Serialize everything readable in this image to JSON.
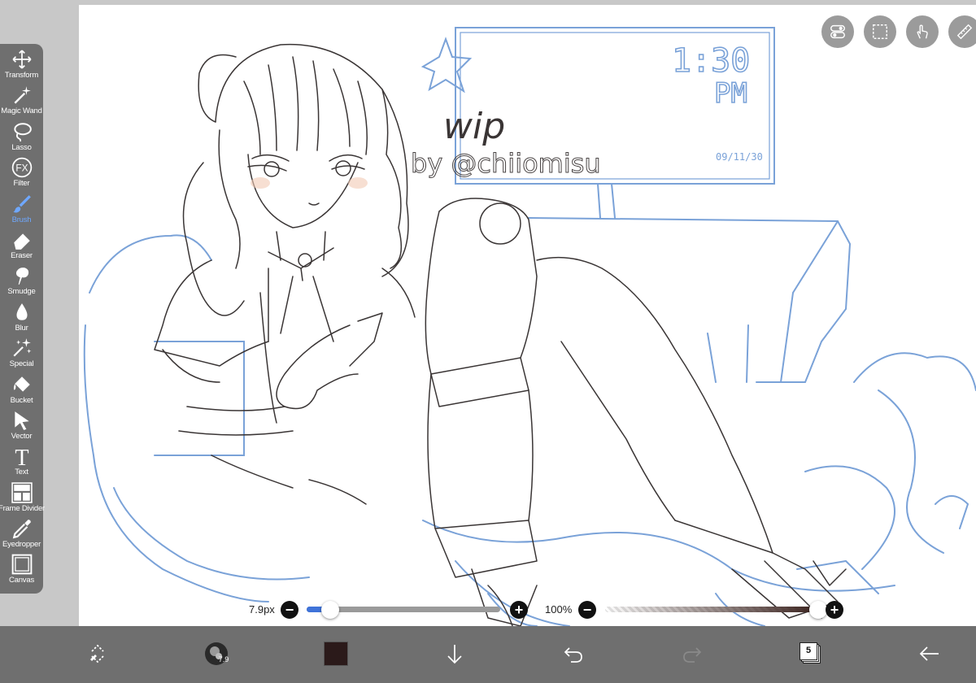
{
  "tools": [
    {
      "id": "transform",
      "label": "Transform",
      "icon": "move-arrows-icon",
      "active": false
    },
    {
      "id": "magic-wand",
      "label": "Magic Wand",
      "icon": "magic-wand-icon",
      "active": false
    },
    {
      "id": "lasso",
      "label": "Lasso",
      "icon": "lasso-icon",
      "active": false
    },
    {
      "id": "filter",
      "label": "Filter",
      "icon": "fx-icon",
      "active": false
    },
    {
      "id": "brush",
      "label": "Brush",
      "icon": "brush-icon",
      "active": true
    },
    {
      "id": "eraser",
      "label": "Eraser",
      "icon": "eraser-icon",
      "active": false
    },
    {
      "id": "smudge",
      "label": "Smudge",
      "icon": "smudge-icon",
      "active": false
    },
    {
      "id": "blur",
      "label": "Blur",
      "icon": "droplet-icon",
      "active": false
    },
    {
      "id": "special",
      "label": "Special",
      "icon": "sparkle-icon",
      "active": false
    },
    {
      "id": "bucket",
      "label": "Bucket",
      "icon": "bucket-icon",
      "active": false
    },
    {
      "id": "vector",
      "label": "Vector",
      "icon": "cursor-arrow-icon",
      "active": false
    },
    {
      "id": "text",
      "label": "Text",
      "icon": "text-t-icon",
      "active": false
    },
    {
      "id": "frame-divider",
      "label": "Frame Divider",
      "icon": "frame-divider-icon",
      "active": false
    },
    {
      "id": "eyedropper",
      "label": "Eyedropper",
      "icon": "eyedropper-icon",
      "active": false
    },
    {
      "id": "canvas",
      "label": "Canvas",
      "icon": "canvas-square-icon",
      "active": false
    }
  ],
  "topButtons": [
    "toggle-icon",
    "selection-rect-icon",
    "touch-hand-icon",
    "ruler-icon"
  ],
  "sliders": {
    "size": {
      "label": "7.9px",
      "fraction": 0.12,
      "fill": "#3f73d9"
    },
    "opacity": {
      "label": "100%",
      "fraction": 1.0
    }
  },
  "bottombar": {
    "items": [
      "swap-icon",
      "brush-preview-icon",
      "color-swatch",
      "down-arrow-icon",
      "undo-icon",
      "redo-icon",
      "layers-icon",
      "back-arrow-icon"
    ],
    "color": "#2b1a1a",
    "layers_count": "5"
  },
  "artwork": {
    "sign_time_line1": "1:30",
    "sign_time_line2": "PM",
    "sign_date": "09/11/30",
    "wip_text": "wip",
    "credit_text": "by @chiiomisu"
  },
  "colors": {
    "toolbar_bg": "#6f6f6f",
    "active_tool": "#6fa8ff",
    "sketch_blue": "#7aa2d8",
    "sketch_line": "#3a3535"
  }
}
